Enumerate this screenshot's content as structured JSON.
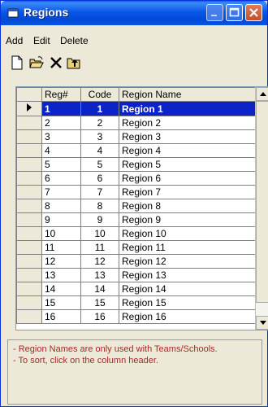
{
  "window": {
    "title": "Regions"
  },
  "menu": [
    "Add",
    "Edit",
    "Delete"
  ],
  "toolbar": [
    {
      "icon": "new-document-icon"
    },
    {
      "icon": "open-folder-icon"
    },
    {
      "icon": "delete-x-icon"
    },
    {
      "icon": "up-folder-icon"
    }
  ],
  "table": {
    "headers": {
      "reg": "Reg#",
      "code": "Code",
      "name": "Region Name"
    },
    "selected_index": 0,
    "rows": [
      {
        "reg": "1",
        "code": "1",
        "name": "Region 1"
      },
      {
        "reg": "2",
        "code": "2",
        "name": "Region 2"
      },
      {
        "reg": "3",
        "code": "3",
        "name": "Region 3"
      },
      {
        "reg": "4",
        "code": "4",
        "name": "Region 4"
      },
      {
        "reg": "5",
        "code": "5",
        "name": "Region 5"
      },
      {
        "reg": "6",
        "code": "6",
        "name": "Region 6"
      },
      {
        "reg": "7",
        "code": "7",
        "name": "Region 7"
      },
      {
        "reg": "8",
        "code": "8",
        "name": "Region 8"
      },
      {
        "reg": "9",
        "code": "9",
        "name": "Region 9"
      },
      {
        "reg": "10",
        "code": "10",
        "name": "Region 10"
      },
      {
        "reg": "11",
        "code": "11",
        "name": "Region 11"
      },
      {
        "reg": "12",
        "code": "12",
        "name": "Region 12"
      },
      {
        "reg": "13",
        "code": "13",
        "name": "Region 13"
      },
      {
        "reg": "14",
        "code": "14",
        "name": "Region 14"
      },
      {
        "reg": "15",
        "code": "15",
        "name": "Region 15"
      },
      {
        "reg": "16",
        "code": "16",
        "name": "Region 16"
      }
    ]
  },
  "notes": [
    "- Region Names are only used with Teams/Schools.",
    "- To sort, click on the column header."
  ],
  "colors": {
    "title_bar": "#0A52E0",
    "selection": "#0A24C8",
    "note_text": "#A52A2A"
  }
}
